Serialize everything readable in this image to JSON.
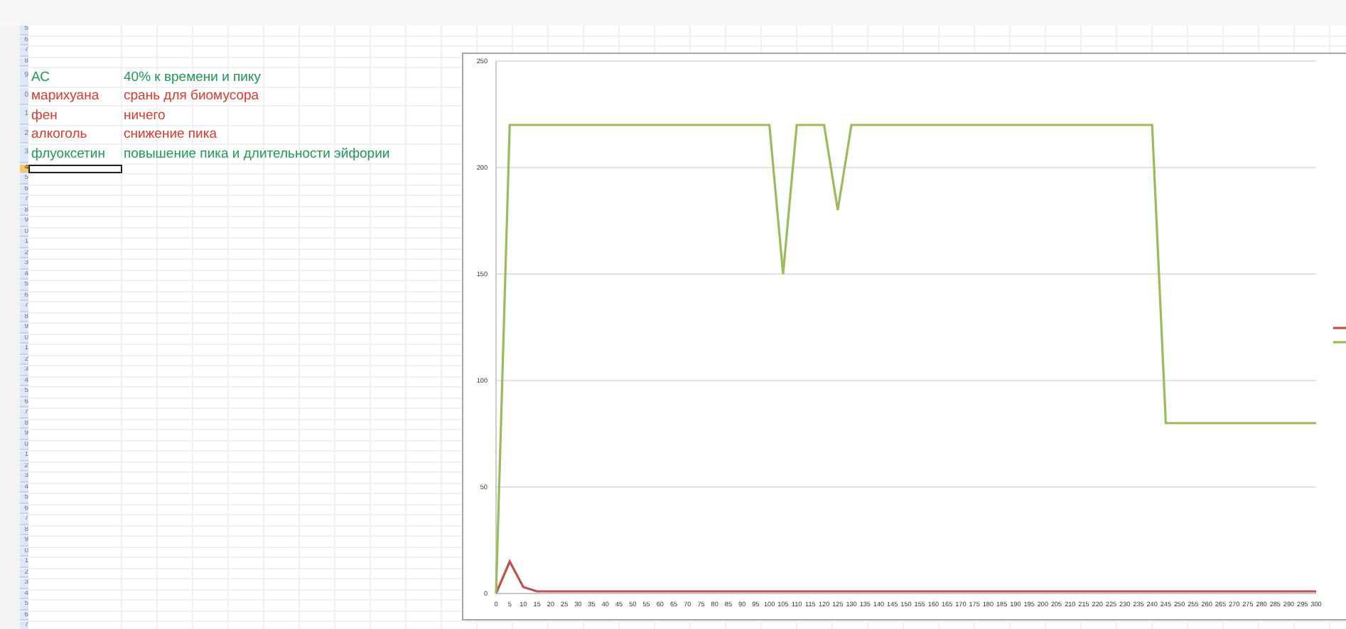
{
  "sheet": {
    "rows": [
      {
        "header": "5",
        "cells": [],
        "selected": false
      },
      {
        "header": "6",
        "cells": [],
        "selected": false
      },
      {
        "header": "7",
        "cells": [],
        "selected": false
      },
      {
        "header": "8",
        "cells": [],
        "selected": false
      },
      {
        "header": "9",
        "cells": [
          "АС",
          "40% к времени и пику"
        ],
        "color": "#1f9a55",
        "selected": false
      },
      {
        "header": "0",
        "cells": [
          "марихуана",
          "срань для биомусора"
        ],
        "color": "#e0382a",
        "selected": false
      },
      {
        "header": "1",
        "cells": [
          "фен",
          "ничего"
        ],
        "color": "#e0382a",
        "selected": false
      },
      {
        "header": "2",
        "cells": [
          "алкоголь",
          "снижение пика"
        ],
        "color": "#e0382a",
        "selected": false
      },
      {
        "header": "3",
        "cells": [
          "флуоксетин",
          "повышение пика и длительности эйфории"
        ],
        "color": "#1f9a55",
        "selected": false
      },
      {
        "header": "4",
        "cells": [],
        "selected": true
      },
      {
        "header": "5",
        "cells": [],
        "selected": false
      },
      {
        "header": "6",
        "cells": [],
        "selected": false
      },
      {
        "header": "7",
        "cells": [],
        "selected": false
      },
      {
        "header": "8",
        "cells": [],
        "selected": false
      },
      {
        "header": "9",
        "cells": [],
        "selected": false
      },
      {
        "header": "0",
        "cells": [],
        "selected": false
      },
      {
        "header": "1",
        "cells": [],
        "selected": false
      },
      {
        "header": "2",
        "cells": [],
        "selected": false
      },
      {
        "header": "3",
        "cells": [],
        "selected": false
      },
      {
        "header": "4",
        "cells": [],
        "selected": false
      },
      {
        "header": "5",
        "cells": [],
        "selected": false
      },
      {
        "header": "6",
        "cells": [],
        "selected": false
      },
      {
        "header": "7",
        "cells": [],
        "selected": false
      },
      {
        "header": "8",
        "cells": [],
        "selected": false
      },
      {
        "header": "9",
        "cells": [],
        "selected": false
      },
      {
        "header": "0",
        "cells": [],
        "selected": false
      },
      {
        "header": "1",
        "cells": [],
        "selected": false
      },
      {
        "header": "2",
        "cells": [],
        "selected": false
      },
      {
        "header": "3",
        "cells": [],
        "selected": false
      },
      {
        "header": "4",
        "cells": [],
        "selected": false
      },
      {
        "header": "5",
        "cells": [],
        "selected": false
      },
      {
        "header": "6",
        "cells": [],
        "selected": false
      },
      {
        "header": "7",
        "cells": [],
        "selected": false
      },
      {
        "header": "8",
        "cells": [],
        "selected": false
      },
      {
        "header": "9",
        "cells": [],
        "selected": false
      },
      {
        "header": "0",
        "cells": [],
        "selected": false
      },
      {
        "header": "1",
        "cells": [],
        "selected": false
      },
      {
        "header": "2",
        "cells": [],
        "selected": false
      },
      {
        "header": "3",
        "cells": [],
        "selected": false
      },
      {
        "header": "4",
        "cells": [],
        "selected": false
      },
      {
        "header": "5",
        "cells": [],
        "selected": false
      },
      {
        "header": "6",
        "cells": [],
        "selected": false
      },
      {
        "header": "7",
        "cells": [],
        "selected": false
      },
      {
        "header": "8",
        "cells": [],
        "selected": false
      },
      {
        "header": "9",
        "cells": [],
        "selected": false
      },
      {
        "header": "0",
        "cells": [],
        "selected": false
      },
      {
        "header": "1",
        "cells": [],
        "selected": false
      },
      {
        "header": "2",
        "cells": [],
        "selected": false
      },
      {
        "header": "3",
        "cells": [],
        "selected": false
      },
      {
        "header": "4",
        "cells": [],
        "selected": false
      },
      {
        "header": "5",
        "cells": [],
        "selected": false
      },
      {
        "header": "6",
        "cells": [],
        "selected": false
      },
      {
        "header": "7",
        "cells": [],
        "selected": false
      }
    ]
  },
  "chart": {
    "chart_data": {
      "type": "line",
      "x": [
        0,
        5,
        10,
        15,
        20,
        25,
        30,
        35,
        40,
        45,
        50,
        55,
        60,
        65,
        70,
        75,
        80,
        85,
        90,
        95,
        100,
        105,
        110,
        115,
        120,
        125,
        130,
        135,
        140,
        145,
        150,
        155,
        160,
        165,
        170,
        175,
        180,
        185,
        190,
        195,
        200,
        205,
        210,
        215,
        220,
        225,
        230,
        235,
        240,
        245,
        250,
        255,
        260,
        265,
        270,
        275,
        280,
        285,
        290,
        295,
        300
      ],
      "ylim": [
        0,
        250
      ],
      "grid": true,
      "yticks": [
        0,
        50,
        100,
        150,
        200,
        250
      ],
      "series": [
        {
          "color": "#c0504d",
          "values": [
            0,
            15,
            3,
            1,
            1,
            1,
            1,
            1,
            1,
            1,
            1,
            1,
            1,
            1,
            1,
            1,
            1,
            1,
            1,
            1,
            1,
            1,
            1,
            1,
            1,
            1,
            1,
            1,
            1,
            1,
            1,
            1,
            1,
            1,
            1,
            1,
            1,
            1,
            1,
            1,
            1,
            1,
            1,
            1,
            1,
            1,
            1,
            1,
            1,
            1,
            1,
            1,
            1,
            1,
            1,
            1,
            1,
            1,
            1,
            1,
            1
          ]
        },
        {
          "color": "#9bbb59",
          "values": [
            0,
            220,
            220,
            220,
            220,
            220,
            220,
            220,
            220,
            220,
            220,
            220,
            220,
            220,
            220,
            220,
            220,
            220,
            220,
            220,
            220,
            150,
            220,
            220,
            220,
            180,
            220,
            220,
            220,
            220,
            220,
            220,
            220,
            220,
            220,
            220,
            220,
            220,
            220,
            220,
            220,
            220,
            220,
            220,
            220,
            220,
            220,
            220,
            220,
            80,
            80,
            80,
            80,
            80,
            80,
            80,
            80,
            80,
            80,
            80,
            80
          ]
        }
      ]
    }
  }
}
